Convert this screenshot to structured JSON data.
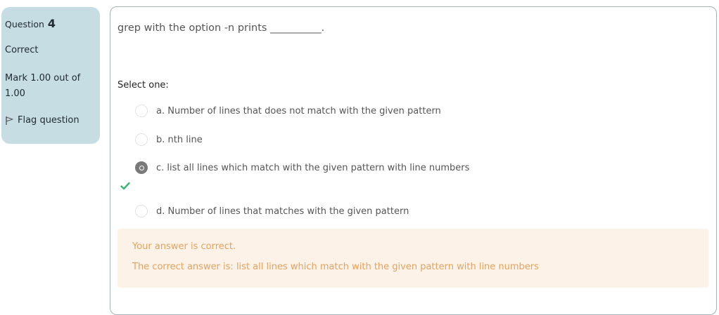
{
  "info": {
    "question_label": "Question",
    "question_number": "4",
    "state": "Correct",
    "grade": "Mark 1.00 out of 1.00",
    "flag_label": "Flag question"
  },
  "question": {
    "text": "grep with the option -n prints __________.",
    "prompt": "Select one:",
    "options": [
      {
        "label": "a. Number of lines that does not match with the given pattern",
        "checked": false
      },
      {
        "label": "b. nth line",
        "checked": false
      },
      {
        "label": "c. list all lines which match with the given pattern with line numbers",
        "checked": true,
        "correct": true
      },
      {
        "label": "d. Number of lines that matches with the given pattern",
        "checked": false
      }
    ]
  },
  "feedback": {
    "status": "Your answer is correct.",
    "correct_answer": "The correct answer is: list all lines which match with the given pattern with line numbers"
  },
  "colors": {
    "info_bg": "#c5dde3",
    "feedback_bg": "#fdf2e7",
    "feedback_text": "#e3a35f",
    "correct_check": "#3cb371"
  },
  "icons": {
    "flag": "flag-icon",
    "correct": "check-icon"
  }
}
